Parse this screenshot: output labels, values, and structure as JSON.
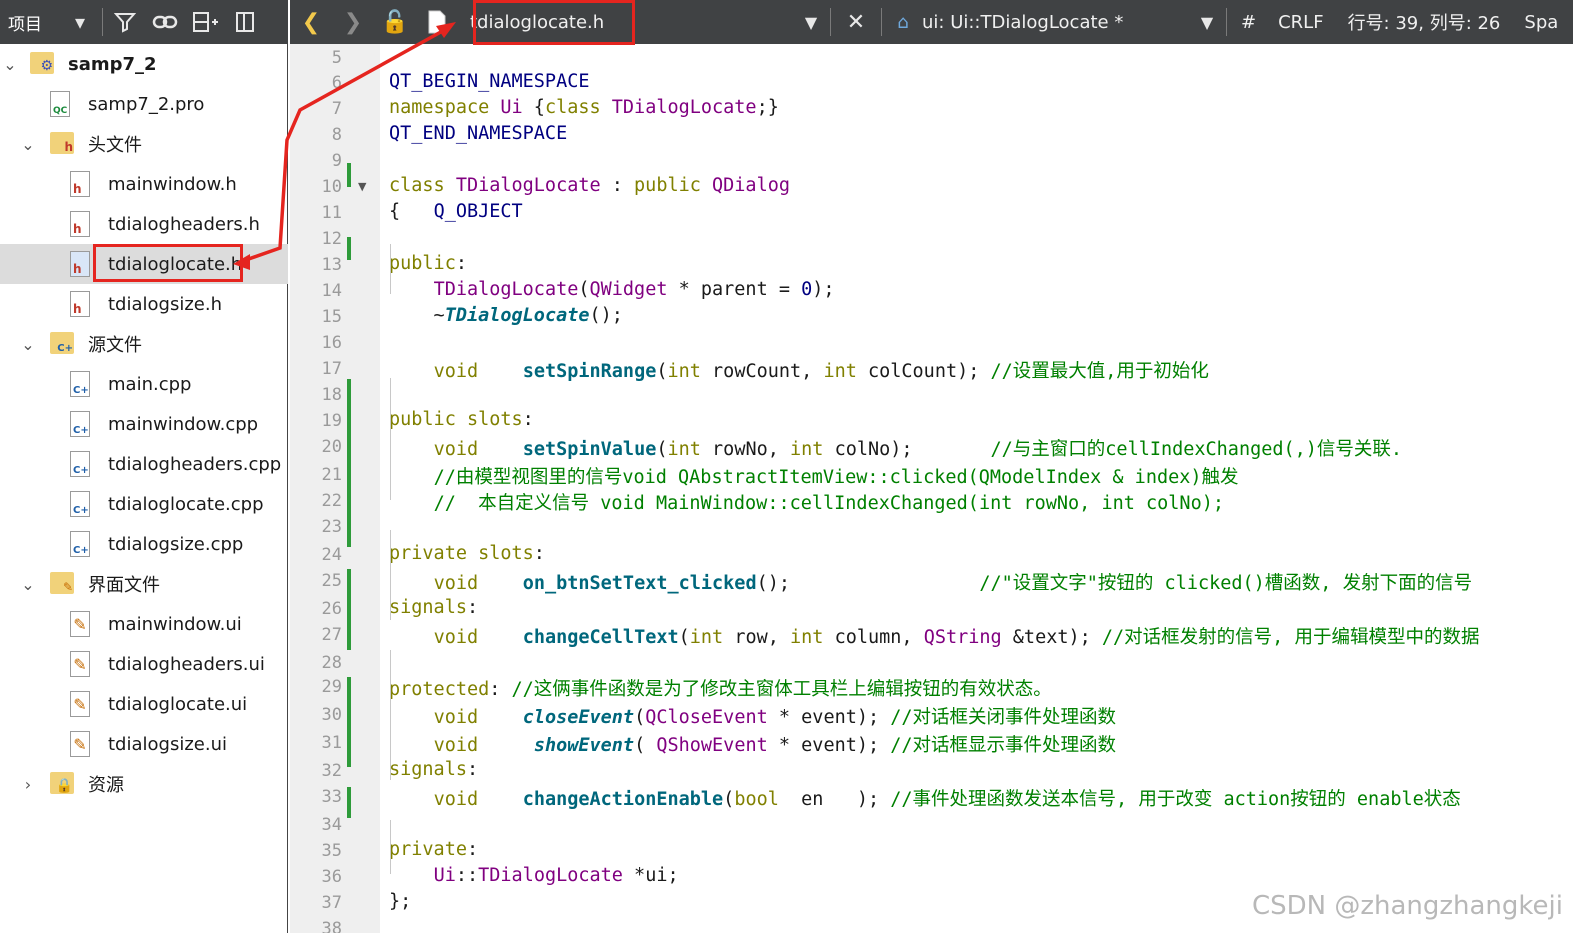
{
  "left_toolbar": {
    "label": "项目",
    "icons": [
      "dropdown-icon",
      "filter-icon",
      "link-icon",
      "split-add-icon",
      "close-pane-icon"
    ]
  },
  "project_tree": {
    "project": "samp7_2",
    "pro_file": "samp7_2.pro",
    "groups": [
      {
        "name": "头文件",
        "expanded": true,
        "files": [
          "mainwindow.h",
          "tdialogheaders.h",
          "tdialoglocate.h",
          "tdialogsize.h"
        ]
      },
      {
        "name": "源文件",
        "expanded": true,
        "files": [
          "main.cpp",
          "mainwindow.cpp",
          "tdialogheaders.cpp",
          "tdialoglocate.cpp",
          "tdialogsize.cpp"
        ]
      },
      {
        "name": "界面文件",
        "expanded": true,
        "files": [
          "mainwindow.ui",
          "tdialogheaders.ui",
          "tdialoglocate.ui",
          "tdialogsize.ui"
        ]
      },
      {
        "name": "资源",
        "expanded": false,
        "files": []
      }
    ],
    "selected_file": "tdialoglocate.h"
  },
  "editor_toolbar": {
    "open_file": "tdialoglocate.h",
    "symbol": "ui: Ui::TDialogLocate *",
    "hash": "#",
    "line_ending": "CRLF",
    "cursor_position": "行号: 39, 列号: 26",
    "trailing": "Spa"
  },
  "code": {
    "first_line": 5,
    "lines": [
      [],
      [
        [
          "mac",
          "QT_BEGIN_NAMESPACE"
        ]
      ],
      [
        [
          "kw",
          "namespace "
        ],
        [
          "cls",
          "Ui"
        ],
        [
          "",
          " {"
        ],
        [
          "kw",
          "class "
        ],
        [
          "cls",
          "TDialogLocate"
        ],
        [
          "",
          ";}"
        ]
      ],
      [
        [
          "mac",
          "QT_END_NAMESPACE"
        ]
      ],
      [],
      [
        [
          "kw",
          "class "
        ],
        [
          "cls",
          "TDialogLocate"
        ],
        [
          "",
          " : "
        ],
        [
          "kw",
          "public "
        ],
        [
          "cls",
          "QDialog"
        ]
      ],
      [
        [
          "",
          "{   "
        ],
        [
          "mac",
          "Q_OBJECT"
        ]
      ],
      [],
      [
        [
          "kw",
          "public"
        ],
        [
          "",
          ":"
        ]
      ],
      [
        [
          "",
          "    "
        ],
        [
          "cls",
          "TDialogLocate"
        ],
        [
          "",
          "("
        ],
        [
          "cls",
          "QWidget"
        ],
        [
          "",
          " * parent = "
        ],
        [
          "num",
          "0"
        ],
        [
          "",
          ");"
        ]
      ],
      [
        [
          "",
          "    ~"
        ],
        [
          "fni",
          "TDialogLocate"
        ],
        [
          "",
          "();"
        ]
      ],
      [],
      [
        [
          "",
          "    "
        ],
        [
          "kw",
          "void"
        ],
        [
          "",
          "    "
        ],
        [
          "fn",
          "setSpinRange"
        ],
        [
          "",
          "("
        ],
        [
          "kw",
          "int"
        ],
        [
          "",
          " rowCount, "
        ],
        [
          "kw",
          "int"
        ],
        [
          "",
          " colCount); "
        ],
        [
          "cm",
          "//设置最大值,用于初始化"
        ]
      ],
      [],
      [
        [
          "kw",
          "public slots"
        ],
        [
          "",
          ":"
        ]
      ],
      [
        [
          "",
          "    "
        ],
        [
          "kw",
          "void"
        ],
        [
          "",
          "    "
        ],
        [
          "fn",
          "setSpinValue"
        ],
        [
          "",
          "("
        ],
        [
          "kw",
          "int"
        ],
        [
          "",
          " rowNo, "
        ],
        [
          "kw",
          "int"
        ],
        [
          "",
          " colNo);       "
        ],
        [
          "cm",
          "//与主窗口的cellIndexChanged(,)信号关联."
        ]
      ],
      [
        [
          "",
          "    "
        ],
        [
          "cm",
          "//由模型视图里的信号void QAbstractItemView::clicked(QModelIndex & index)触发"
        ]
      ],
      [
        [
          "",
          "    "
        ],
        [
          "cm",
          "//  本自定义信号 void MainWindow::cellIndexChanged(int rowNo, int colNo);"
        ]
      ],
      [],
      [
        [
          "kw",
          "private slots"
        ],
        [
          "",
          ":"
        ]
      ],
      [
        [
          "",
          "    "
        ],
        [
          "kw",
          "void"
        ],
        [
          "",
          "    "
        ],
        [
          "fn",
          "on_btnSetText_clicked"
        ],
        [
          "",
          "();                 "
        ],
        [
          "cm",
          "//\"设置文字\"按钮的 clicked()槽函数, 发射下面的信号"
        ]
      ],
      [
        [
          "kw",
          "signals"
        ],
        [
          "",
          ":"
        ]
      ],
      [
        [
          "",
          "    "
        ],
        [
          "kw",
          "void"
        ],
        [
          "",
          "    "
        ],
        [
          "fn",
          "changeCellText"
        ],
        [
          "",
          "("
        ],
        [
          "kw",
          "int"
        ],
        [
          "",
          " row, "
        ],
        [
          "kw",
          "int"
        ],
        [
          "",
          " column, "
        ],
        [
          "cls",
          "QString"
        ],
        [
          "",
          " &text); "
        ],
        [
          "cm",
          "//对话框发射的信号, 用于编辑模型中的数据"
        ]
      ],
      [],
      [
        [
          "kw",
          "protected"
        ],
        [
          "",
          ": "
        ],
        [
          "cm",
          "//这俩事件函数是为了修改主窗体工具栏上编辑按钮的有效状态。"
        ]
      ],
      [
        [
          "",
          "    "
        ],
        [
          "kw",
          "void"
        ],
        [
          "",
          "    "
        ],
        [
          "fnn",
          "closeEvent"
        ],
        [
          "",
          "("
        ],
        [
          "cls",
          "QCloseEvent"
        ],
        [
          "",
          " * event); "
        ],
        [
          "cm",
          "//对话框关闭事件处理函数"
        ]
      ],
      [
        [
          "",
          "    "
        ],
        [
          "kw",
          "void"
        ],
        [
          "",
          "     "
        ],
        [
          "fnn",
          "showEvent"
        ],
        [
          "",
          "( "
        ],
        [
          "cls",
          "QShowEvent"
        ],
        [
          "",
          " * event); "
        ],
        [
          "cm",
          "//对话框显示事件处理函数"
        ]
      ],
      [
        [
          "kw",
          "signals"
        ],
        [
          "",
          ":"
        ]
      ],
      [
        [
          "",
          "    "
        ],
        [
          "kw",
          "void"
        ],
        [
          "",
          "    "
        ],
        [
          "fn",
          "changeActionEnable"
        ],
        [
          "",
          "("
        ],
        [
          "kw",
          "bool"
        ],
        [
          "",
          "  en   ); "
        ],
        [
          "cm",
          "//事件处理函数发送本信号, 用于改变 action按钮的 enable状态"
        ]
      ],
      [],
      [
        [
          "kw",
          "private"
        ],
        [
          "",
          ":"
        ]
      ],
      [
        [
          "",
          "    "
        ],
        [
          "cls",
          "Ui"
        ],
        [
          "",
          "::"
        ],
        [
          "cls",
          "TDialogLocate"
        ],
        [
          "",
          " *ui;"
        ]
      ],
      [
        [
          "",
          "};"
        ]
      ],
      []
    ]
  },
  "watermark": "CSDN @zhangzhangkeji"
}
